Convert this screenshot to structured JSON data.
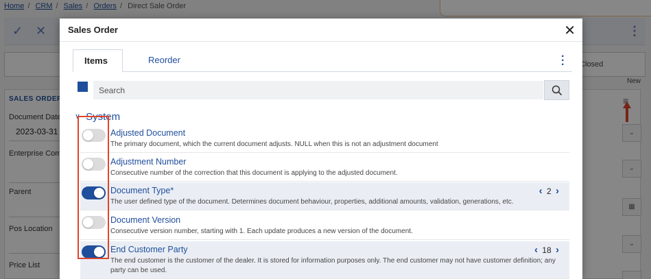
{
  "breadcrumb": [
    "Home",
    "CRM",
    "Sales",
    "Orders",
    "Direct Sale Order"
  ],
  "background": {
    "status_closed": "Closed",
    "new_label": "New",
    "section_title": "SALES ORDER",
    "fields": [
      {
        "label": "Document Date",
        "value": "2023-03-31"
      },
      {
        "label": "Enterprise Compa",
        "value": ""
      },
      {
        "label": "Parent",
        "value": ""
      },
      {
        "label": "Pos Location",
        "value": ""
      },
      {
        "label": "Price List",
        "value": ""
      }
    ]
  },
  "dialog": {
    "title": "Sales Order",
    "tabs": [
      "Items",
      "Reorder"
    ],
    "search_placeholder": "Search",
    "section": "System",
    "items": [
      {
        "title": "Adjusted Document",
        "desc": "The primary document, which the current document adjusts. NULL when this is not an adjustment document",
        "on": false
      },
      {
        "title": "Adjustment Number",
        "desc": "Consecutive number of the correction that this document is applying to the adjusted document.",
        "on": false
      },
      {
        "title": "Document Type*",
        "desc": "The user defined type of the document. Determines document behaviour, properties, additional amounts, validation, generations, etc.",
        "on": true,
        "order": "2"
      },
      {
        "title": "Document Version",
        "desc": "Consecutive version number, starting with 1. Each update produces a new version of the document.",
        "on": false
      },
      {
        "title": "End Customer Party",
        "desc": "The end customer is the customer of the dealer. It is stored for information purposes only. The end customer may not have customer definition; any party can be used.",
        "on": true,
        "order": "18"
      }
    ]
  },
  "colors": {
    "accent": "#1f4e9c",
    "highlight": "#e0452b"
  }
}
